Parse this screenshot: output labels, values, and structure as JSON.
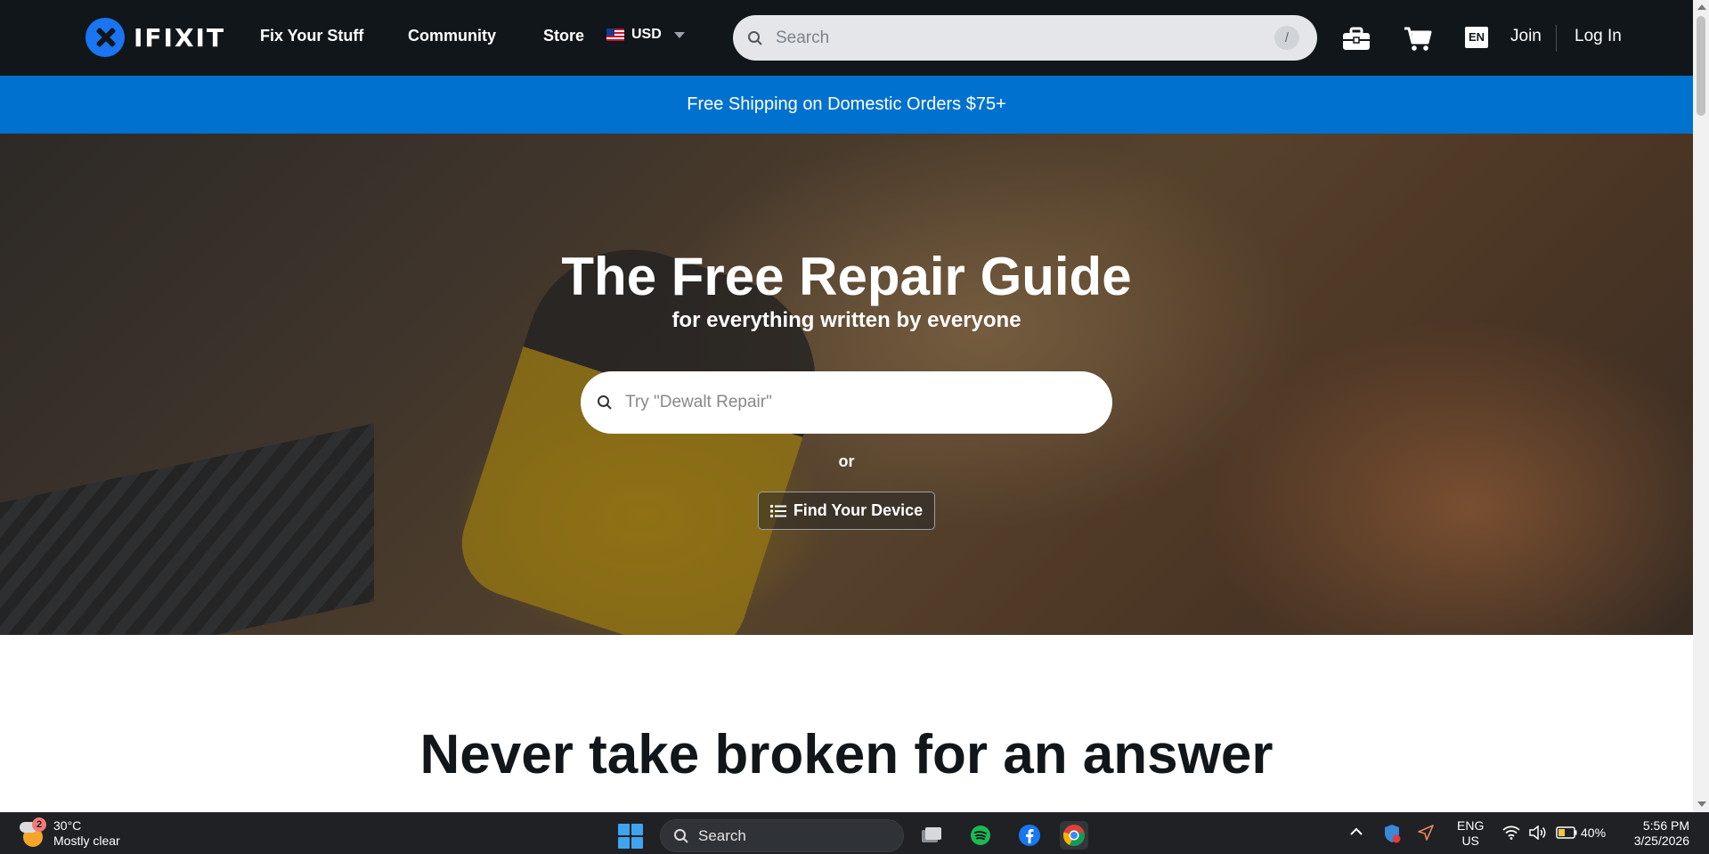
{
  "header": {
    "logo_text": "IFIXIT",
    "nav": [
      "Fix Your Stuff",
      "Community",
      "Store"
    ],
    "currency": "USD",
    "search_placeholder": "Search",
    "search_shortcut": "/",
    "language": "EN",
    "join": "Join",
    "login": "Log In"
  },
  "banner": {
    "text": "Free Shipping on Domestic Orders $75+"
  },
  "hero": {
    "title": "The Free Repair Guide",
    "subtitle": "for everything written by everyone",
    "search_placeholder": "Try \"Dewalt Repair\"",
    "or": "or",
    "find_device": "Find Your Device"
  },
  "section": {
    "title": "Never take broken for an answer"
  },
  "taskbar": {
    "weather_badge": "2",
    "temperature": "30°C",
    "condition": "Mostly clear",
    "search_label": "Search",
    "lang_primary": "ENG",
    "lang_secondary": "US",
    "battery": "40%",
    "time": "5:56 PM",
    "date": "3/25/2026"
  },
  "colors": {
    "nav_bg": "#11161a",
    "banner_bg": "#0071ce",
    "logo_blue": "#1975f1",
    "taskbar_bg": "#1f2124"
  },
  "icons": {
    "toolbox": "toolbox-icon",
    "cart": "cart-icon",
    "search": "search-icon",
    "list": "list-icon"
  }
}
